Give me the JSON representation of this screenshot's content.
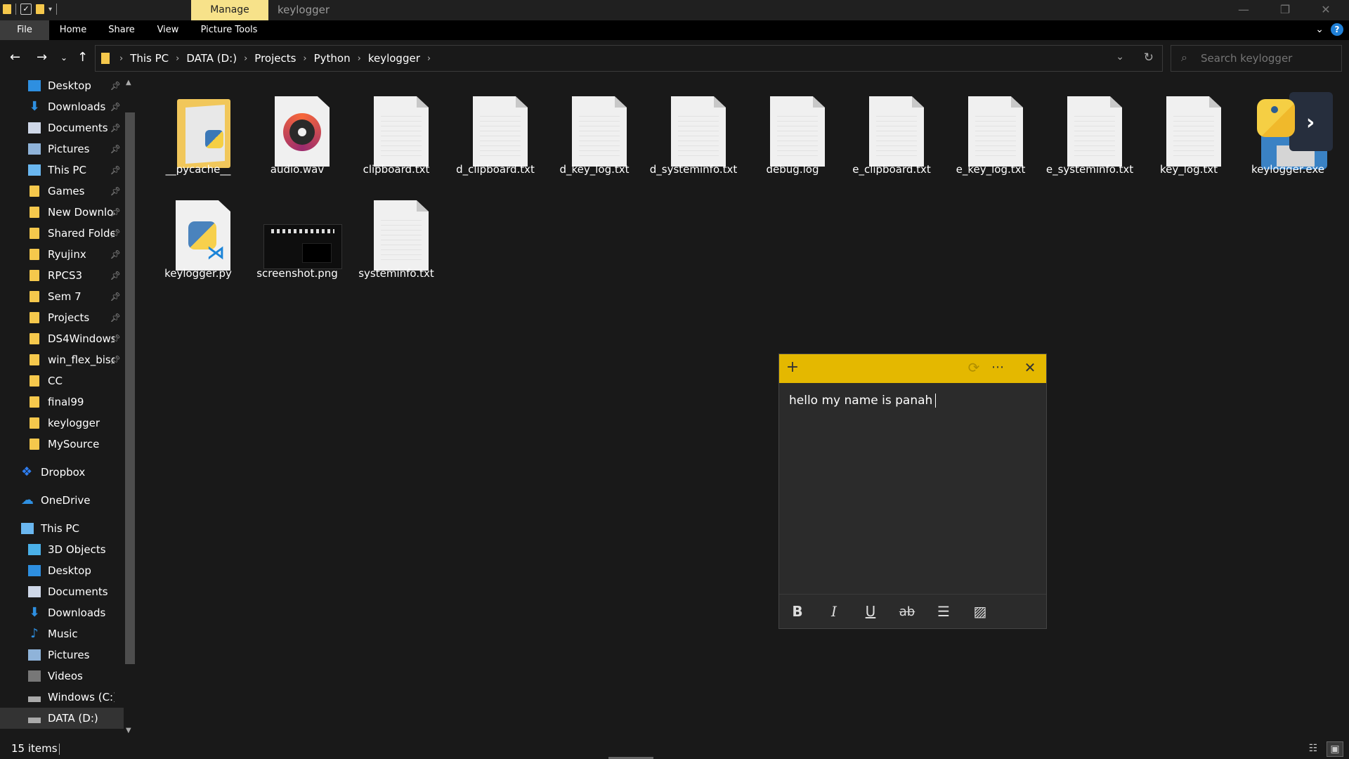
{
  "titlebar": {
    "contextual_tab": "Manage",
    "window_title": "keylogger",
    "minimize": "—",
    "maximize": "❐",
    "close": "✕"
  },
  "ribbon": {
    "tabs": [
      "File",
      "Home",
      "Share",
      "View",
      "Picture Tools"
    ]
  },
  "address": {
    "breadcrumbs": [
      "This PC",
      "DATA (D:)",
      "Projects",
      "Python",
      "keylogger"
    ]
  },
  "search": {
    "placeholder": "Search keylogger"
  },
  "navpane": {
    "quick_access": [
      {
        "label": "Desktop",
        "icon": "desktop-icon",
        "pinned": true
      },
      {
        "label": "Downloads",
        "icon": "downloads-icon",
        "pinned": true
      },
      {
        "label": "Documents",
        "icon": "documents-icon",
        "pinned": true
      },
      {
        "label": "Pictures",
        "icon": "pictures-icon",
        "pinned": true
      },
      {
        "label": "This PC",
        "icon": "pc-icon",
        "pinned": true
      },
      {
        "label": "Games",
        "icon": "folder-icon",
        "pinned": true
      },
      {
        "label": "New Downloa",
        "icon": "folder-icon",
        "pinned": true
      },
      {
        "label": "Shared Folde",
        "icon": "folder-icon",
        "pinned": true
      },
      {
        "label": "Ryujinx",
        "icon": "folder-icon",
        "pinned": true
      },
      {
        "label": "RPCS3",
        "icon": "folder-icon",
        "pinned": true
      },
      {
        "label": "Sem 7",
        "icon": "folder-icon",
        "pinned": true
      },
      {
        "label": "Projects",
        "icon": "folder-icon",
        "pinned": true
      },
      {
        "label": "DS4Windows",
        "icon": "folder-icon",
        "pinned": true
      },
      {
        "label": "win_flex_biso",
        "icon": "folder-icon",
        "pinned": true
      },
      {
        "label": "CC",
        "icon": "folder-icon",
        "pinned": false
      },
      {
        "label": "final99",
        "icon": "folder-icon",
        "pinned": false
      },
      {
        "label": "keylogger",
        "icon": "folder-icon",
        "pinned": false
      },
      {
        "label": "MySource",
        "icon": "folder-icon",
        "pinned": false
      }
    ],
    "dropbox": "Dropbox",
    "onedrive": "OneDrive",
    "this_pc": "This PC",
    "this_pc_items": [
      {
        "label": "3D Objects",
        "icon": "3d-objects-icon"
      },
      {
        "label": "Desktop",
        "icon": "desktop-icon"
      },
      {
        "label": "Documents",
        "icon": "documents-icon"
      },
      {
        "label": "Downloads",
        "icon": "downloads-icon"
      },
      {
        "label": "Music",
        "icon": "music-icon"
      },
      {
        "label": "Pictures",
        "icon": "pictures-icon"
      },
      {
        "label": "Videos",
        "icon": "videos-icon"
      },
      {
        "label": "Windows (C:)",
        "icon": "drive-icon"
      },
      {
        "label": "DATA (D:)",
        "icon": "drive-icon"
      }
    ]
  },
  "files": [
    {
      "name": "__pycache__",
      "type": "folder"
    },
    {
      "name": "audio.wav",
      "type": "audio"
    },
    {
      "name": "clipboard.txt",
      "type": "text"
    },
    {
      "name": "d_clipboard.txt",
      "type": "text"
    },
    {
      "name": "d_key_log.txt",
      "type": "text"
    },
    {
      "name": "d_systeminfo.txt",
      "type": "text"
    },
    {
      "name": "debug.log",
      "type": "text"
    },
    {
      "name": "e_clipboard.txt",
      "type": "text"
    },
    {
      "name": "e_key_log.txt",
      "type": "text"
    },
    {
      "name": "e_systeminfo.txt",
      "type": "text"
    },
    {
      "name": "key_log.txt",
      "type": "text"
    },
    {
      "name": "keylogger.exe",
      "type": "exe"
    },
    {
      "name": "keylogger.py",
      "type": "python"
    },
    {
      "name": "screenshot.png",
      "type": "image"
    },
    {
      "name": "systeminfo.txt",
      "type": "text"
    }
  ],
  "sticky_note": {
    "text": "hello my name is panah",
    "header_color": "#e4b800",
    "format_tools": [
      "bold",
      "italic",
      "underline",
      "strikethrough",
      "bullets",
      "image"
    ]
  },
  "status": {
    "item_count": "15 items"
  },
  "colors": {
    "background": "#191919",
    "folder": "#f5c84c",
    "accent": "#1f7fd6"
  }
}
